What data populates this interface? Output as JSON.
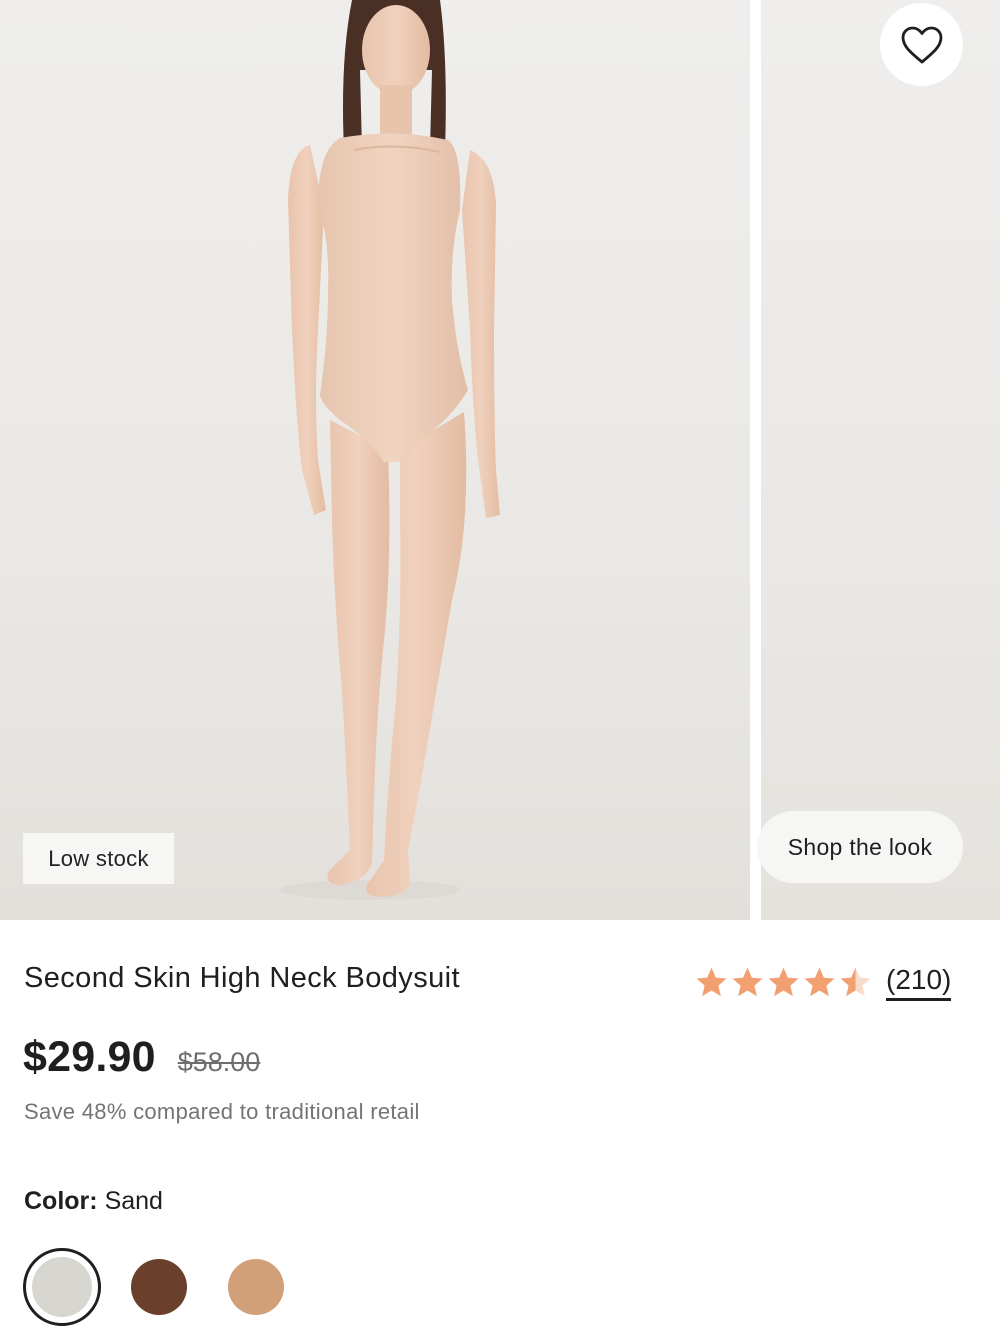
{
  "gallery": {
    "badge": "Low stock",
    "shop_the_look": "Shop the look"
  },
  "product": {
    "title": "Second Skin High Neck Bodysuit",
    "rating_value": 4.5,
    "rating_max": 5,
    "review_count": "(210)",
    "price": "$29.90",
    "compare_price": "$58.00",
    "savings": "Save 48% compared to traditional retail",
    "color_label": "Color:",
    "color_value": "Sand",
    "star_color": "#f2a071"
  },
  "swatches": [
    {
      "name": "Sand",
      "color": "#d8d6d0",
      "selected": true
    },
    {
      "name": "Brown",
      "color": "#6a3f2c",
      "selected": false
    },
    {
      "name": "Tan",
      "color": "#d19f78",
      "selected": false
    }
  ],
  "icons": {
    "favorite": "heart-icon",
    "rating": "star-icon"
  }
}
